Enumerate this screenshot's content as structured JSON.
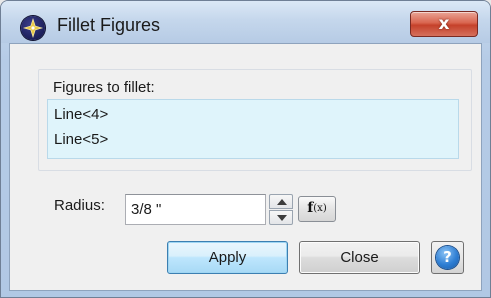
{
  "window": {
    "title": "Fillet Figures",
    "close_glyph": "x",
    "app_icon": "star-compass-icon"
  },
  "figures": {
    "label": "Figures to fillet:",
    "items": [
      "Line<4>",
      "Line<5>"
    ]
  },
  "radius": {
    "label": "Radius:",
    "value": "3/8 \""
  },
  "fx_button": {
    "f": "f",
    "x": "(x)"
  },
  "buttons": {
    "apply": "Apply",
    "close": "Close",
    "help_glyph": "?"
  },
  "colors": {
    "list_background": "#dff4fb",
    "apply_hover": "#bee6fd",
    "close_button_red": "#c5412a",
    "help_blue": "#2f7fd4"
  }
}
